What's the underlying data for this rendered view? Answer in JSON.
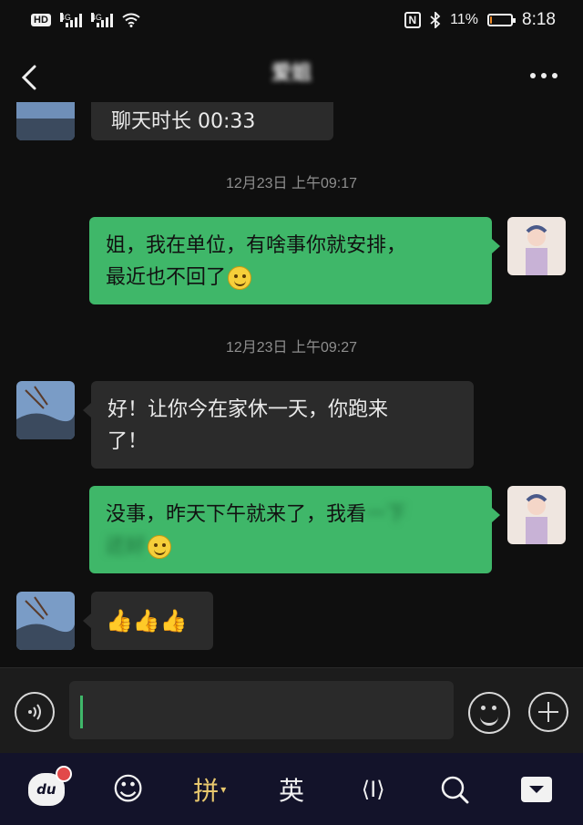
{
  "status_bar": {
    "hd_label": "HD",
    "sim1_label": "4G",
    "sim2_label": "4G",
    "nfc_label": "N",
    "bluetooth_icon": "bluetooth-icon",
    "battery_percent": "11%",
    "battery_level": 0.11,
    "time": "8:18"
  },
  "header": {
    "title": "爱姐",
    "back_icon": "chevron-left-icon",
    "more_icon": "more-dots-icon"
  },
  "chat": {
    "messages": [
      {
        "type": "incoming",
        "text": "聊天时长 00:33"
      },
      {
        "type": "timestamp",
        "text": "12月23日 上午09:17"
      },
      {
        "type": "outgoing",
        "line1": "姐，我在单位，有啥事你就安排，",
        "line2": "最近也不回了",
        "emoji": "smile-emoji"
      },
      {
        "type": "timestamp",
        "text": "12月23日 上午09:27"
      },
      {
        "type": "incoming",
        "line1": "好！让你今在家休一天，你跑来",
        "line2": "了！"
      },
      {
        "type": "outgoing",
        "line1": "没事，昨天下午就来了，我看",
        "hidden1": "一下",
        "hidden2": "还好",
        "emoji": "grin-emoji"
      },
      {
        "type": "incoming",
        "text": "👍👍👍"
      }
    ]
  },
  "input_bar": {
    "voice_icon": "voice-icon",
    "input_value": "",
    "emoji_icon": "emoji-icon",
    "plus_icon": "plus-icon"
  },
  "keyboard_bar": {
    "items": [
      {
        "name": "du-logo",
        "label": "du"
      },
      {
        "name": "emoji",
        "label": "☺"
      },
      {
        "name": "pinyin",
        "label": "拼"
      },
      {
        "name": "english",
        "label": "英"
      },
      {
        "name": "cursor",
        "label": "⟨I⟩"
      },
      {
        "name": "search",
        "label": ""
      },
      {
        "name": "hide-keyboard",
        "label": ""
      }
    ]
  },
  "colors": {
    "outgoing_bubble": "#3fb769",
    "incoming_bubble": "#2b2b2b",
    "background": "#0f0f0f",
    "keyboard_bar": "#13132a",
    "battery_fill": "#f28c28"
  }
}
